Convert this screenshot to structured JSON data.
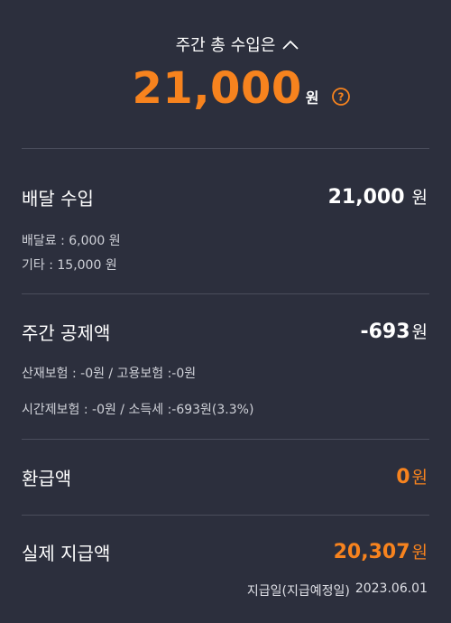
{
  "header": {
    "title": "주간 총 수입은",
    "total_amount": "21,000",
    "total_unit": "원",
    "help_icon": "question-circle-icon",
    "toggle_icon": "chevron-up-icon"
  },
  "delivery_income": {
    "title": "배달 수입",
    "amount": "21,000",
    "unit": "원",
    "details": [
      "배달료 : 6,000 원",
      "기타 : 15,000 원"
    ]
  },
  "weekly_deduction": {
    "title": "주간 공제액",
    "amount": "-693",
    "unit": "원",
    "details": [
      "산재보험 : -0원 / 고용보험 :-0원",
      "시간제보험 : -0원 / 소득세 :-693원(3.3%)"
    ]
  },
  "refund": {
    "title": "환급액",
    "amount": "0",
    "unit": "원"
  },
  "actual_payment": {
    "title": "실제 지급액",
    "amount": "20,307",
    "unit": "원"
  },
  "payday": {
    "label": "지급일(지급예정일)",
    "date": "2023.06.01"
  },
  "colors": {
    "background": "#2c2f3d",
    "accent": "#f7831e",
    "divider": "#4a4d5c"
  }
}
